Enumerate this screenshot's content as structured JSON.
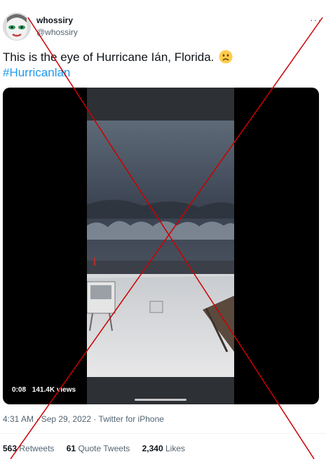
{
  "author": {
    "display_name": "whossiry",
    "handle": "@whossiry",
    "avatar_icon": "avatar-face"
  },
  "more_icon": "more-icon",
  "tweet": {
    "text": "This is the eye of Hurricane Ián, Florida.",
    "emoji": "frowning-face-emoji",
    "hashtag": "#Hurricanlan"
  },
  "video": {
    "duration": "0:08",
    "views": "141.4K views"
  },
  "meta": {
    "timestamp": "4:31 AM · Sep 29, 2022 · Twitter for iPhone"
  },
  "stats": {
    "retweets_count": "563",
    "retweets_label": "Retweets",
    "quotes_count": "61",
    "quotes_label": "Quote Tweets",
    "likes_count": "2,340",
    "likes_label": "Likes"
  },
  "overlay": {
    "type": "red-x-cross",
    "color": "#cc0000"
  },
  "colors": {
    "link": "#1d9bf0",
    "muted": "#536471",
    "text": "#0f1419"
  }
}
